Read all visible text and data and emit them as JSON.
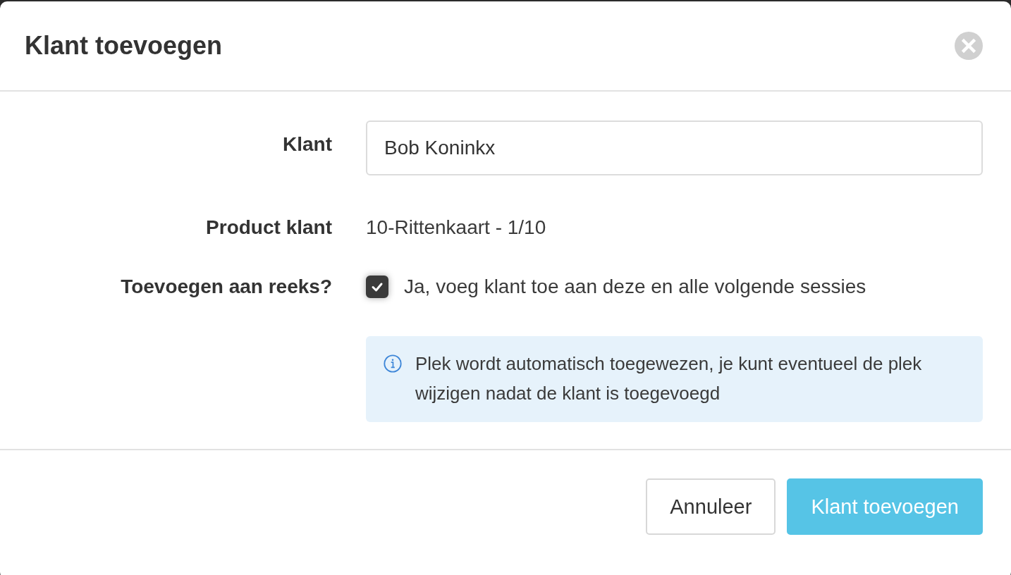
{
  "dialog": {
    "title": "Klant toevoegen"
  },
  "fields": [
    {
      "kind": "input",
      "label": "Klant",
      "value": "Bob Koninkx"
    },
    {
      "kind": "text",
      "label": "Product klant",
      "value": "10-Rittenkaart - 1/10"
    },
    {
      "kind": "checkbox",
      "label": "Toevoegen aan reeks?",
      "value": "Ja, voeg klant toe aan deze en alle volgende sessies",
      "checked": true
    }
  ],
  "info": "Plek wordt automatisch toegewezen, je kunt eventueel de plek wijzigen nadat de klant is toegevoegd",
  "buttons": [
    {
      "label": "Annuleer",
      "kind": "secondary"
    },
    {
      "label": "Klant toevoegen",
      "kind": "primary"
    }
  ]
}
